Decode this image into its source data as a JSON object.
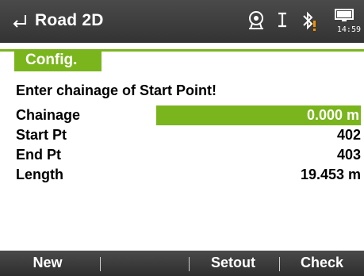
{
  "header": {
    "title": "Road 2D",
    "back_icon": "back-arrow-icon",
    "status_icons": [
      "total-station-icon",
      "prism-icon",
      "bluetooth-warning-icon",
      "battery-icon"
    ],
    "clock": "14:59"
  },
  "tabs": [
    {
      "label": "Config.",
      "active": true
    }
  ],
  "main": {
    "message": "Enter chainage of Start Point!",
    "fields": [
      {
        "label": "Chainage",
        "value": "0.000 m",
        "editable": true
      },
      {
        "label": "Start Pt",
        "value": "402",
        "editable": false
      },
      {
        "label": "End Pt",
        "value": "403",
        "editable": false
      },
      {
        "label": "Length",
        "value": "19.453 m",
        "editable": false
      }
    ]
  },
  "softkeys": [
    "New",
    "",
    "",
    "Setout",
    "Check"
  ],
  "colors": {
    "accent": "#7ab51d",
    "bar": "#3a3a3a",
    "warning": "#f29100"
  }
}
